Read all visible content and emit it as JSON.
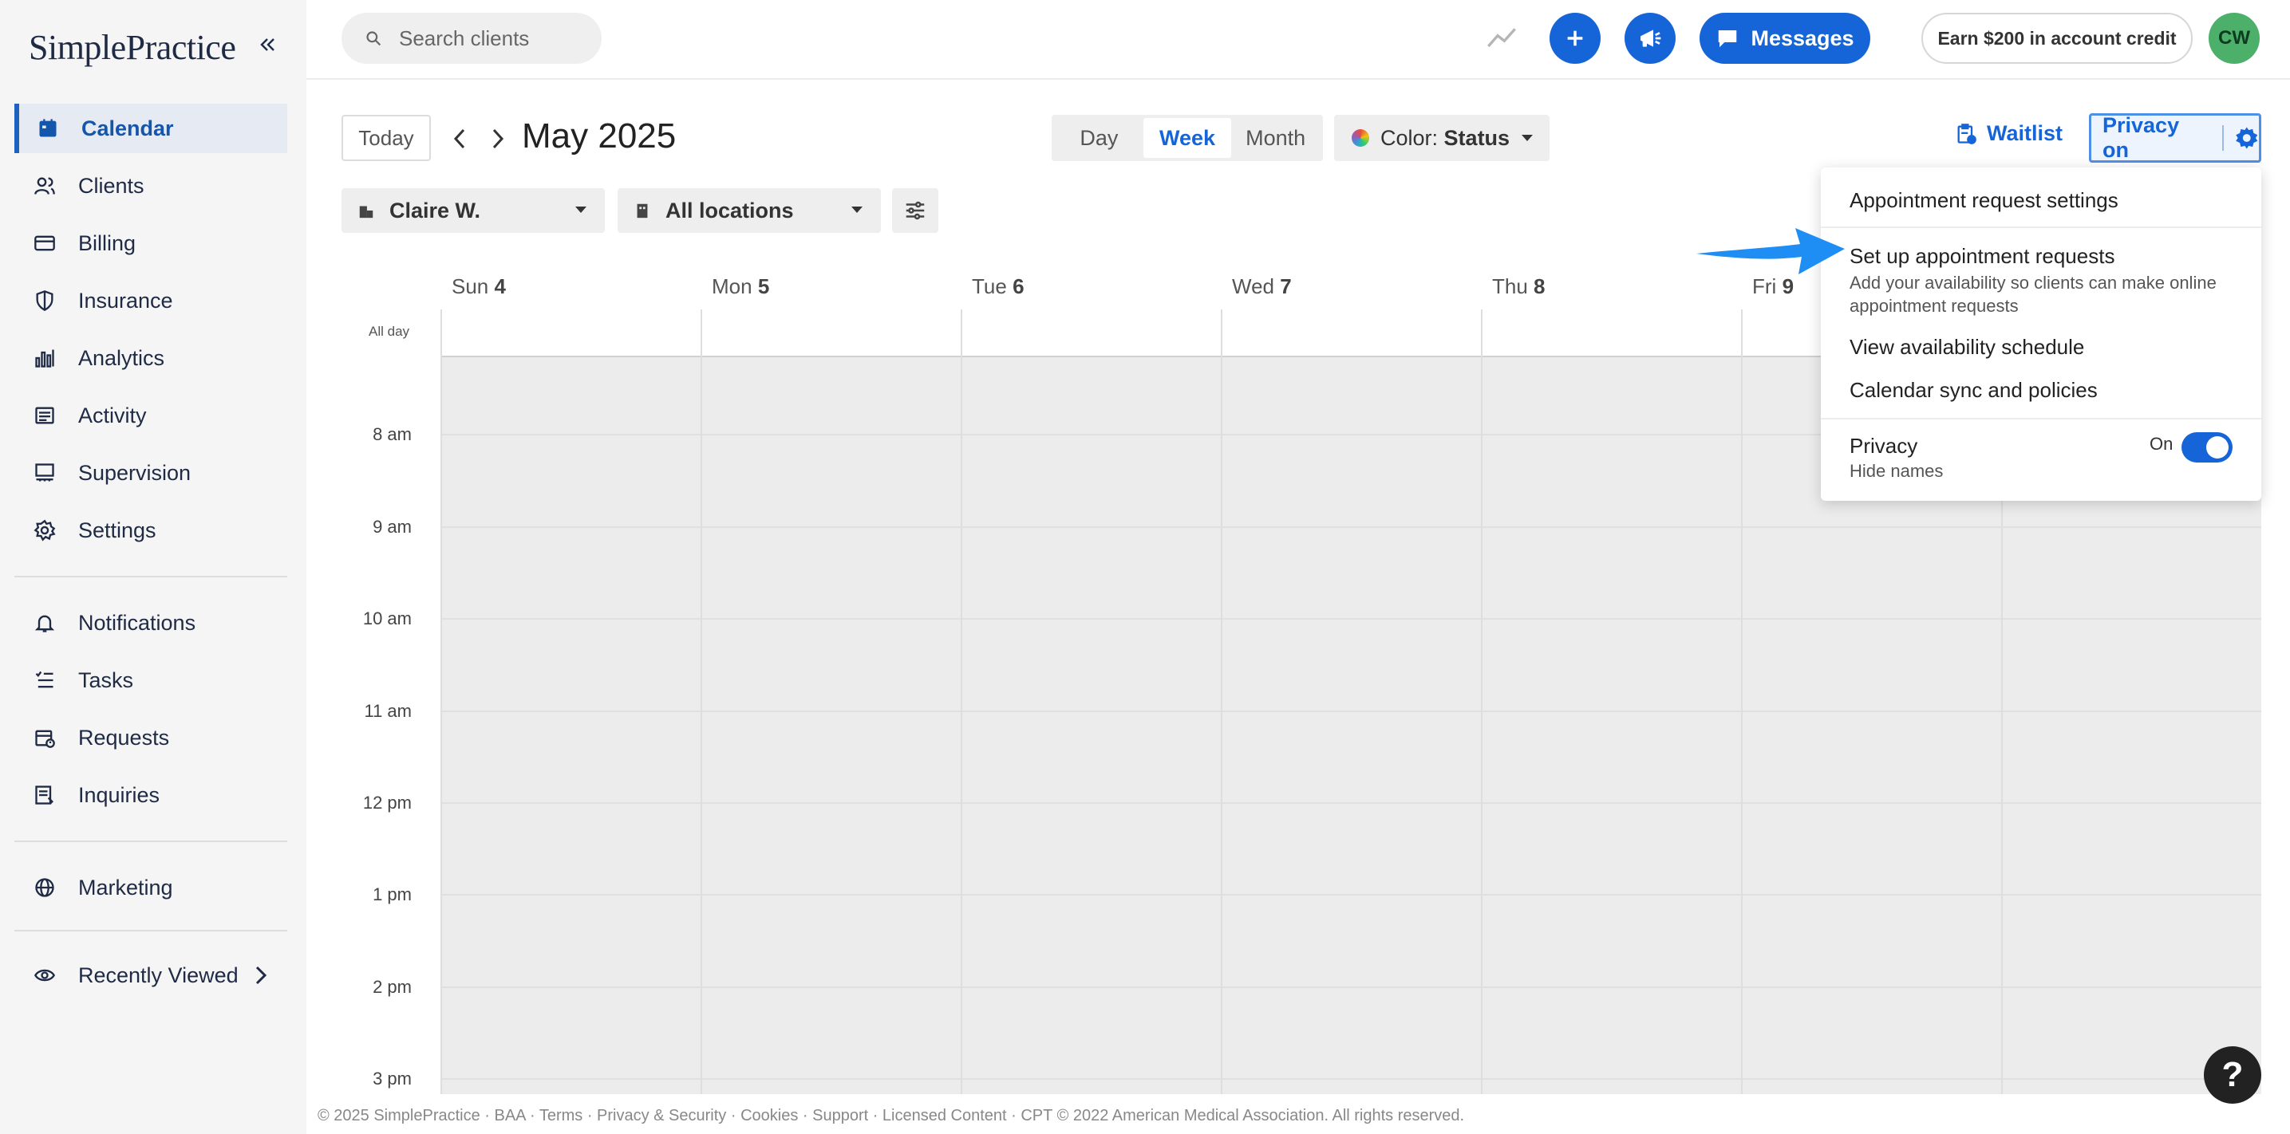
{
  "app": {
    "logo_text": "SimplePractice",
    "accent": "#1565d8"
  },
  "sidebar": {
    "items": [
      {
        "label": "Calendar",
        "icon": "calendar-icon",
        "active": true
      },
      {
        "label": "Clients",
        "icon": "clients-icon"
      },
      {
        "label": "Billing",
        "icon": "billing-card-icon"
      },
      {
        "label": "Insurance",
        "icon": "shield-icon"
      },
      {
        "label": "Analytics",
        "icon": "bar-chart-icon"
      },
      {
        "label": "Activity",
        "icon": "activity-list-icon"
      },
      {
        "label": "Supervision",
        "icon": "supervision-icon"
      },
      {
        "label": "Settings",
        "icon": "gear-icon"
      }
    ],
    "items2": [
      {
        "label": "Notifications",
        "icon": "bell-icon"
      },
      {
        "label": "Tasks",
        "icon": "tasks-icon"
      },
      {
        "label": "Requests",
        "icon": "requests-calendar-icon"
      },
      {
        "label": "Inquiries",
        "icon": "inquiries-icon"
      }
    ],
    "marketing": {
      "label": "Marketing",
      "icon": "globe-icon"
    },
    "recently_viewed": {
      "label": "Recently Viewed",
      "icon": "eye-icon"
    }
  },
  "header": {
    "search_placeholder": "Search clients",
    "messages_label": "Messages",
    "credit_label": "Earn $200 in account credit",
    "avatar_initials": "CW"
  },
  "toolbar": {
    "today_label": "Today",
    "month_title": "May 2025",
    "views": [
      {
        "label": "Day",
        "active": false
      },
      {
        "label": "Week",
        "active": true
      },
      {
        "label": "Month",
        "active": false
      }
    ],
    "color_prefix": "Color:",
    "color_value": "Status",
    "waitlist_label": "Waitlist",
    "privacy_label": "Privacy on",
    "clinician_filter": "Claire W.",
    "location_filter": "All locations"
  },
  "calendar": {
    "days": [
      {
        "name": "Sun",
        "num": "4"
      },
      {
        "name": "Mon",
        "num": "5"
      },
      {
        "name": "Tue",
        "num": "6"
      },
      {
        "name": "Wed",
        "num": "7"
      },
      {
        "name": "Thu",
        "num": "8"
      },
      {
        "name": "Fri",
        "num": "9"
      }
    ],
    "all_day_label": "All day",
    "times": [
      "8 am",
      "9 am",
      "10 am",
      "11 am",
      "12 pm",
      "1 pm",
      "2 pm",
      "3 pm"
    ]
  },
  "dropdown": {
    "item1": "Appointment request settings",
    "item2_title": "Set up appointment requests",
    "item2_sub": "Add your availability so clients can make online appointment requests",
    "item3": "View availability schedule",
    "item4": "Calendar sync and policies",
    "privacy_title": "Privacy",
    "privacy_sub": "Hide names",
    "toggle_label": "On"
  },
  "footer": {
    "text": "© 2025 SimplePractice · BAA · Terms · Privacy & Security · Cookies · Support · Licensed Content · CPT © 2022 American Medical Association. All rights reserved."
  },
  "help_label": "?"
}
